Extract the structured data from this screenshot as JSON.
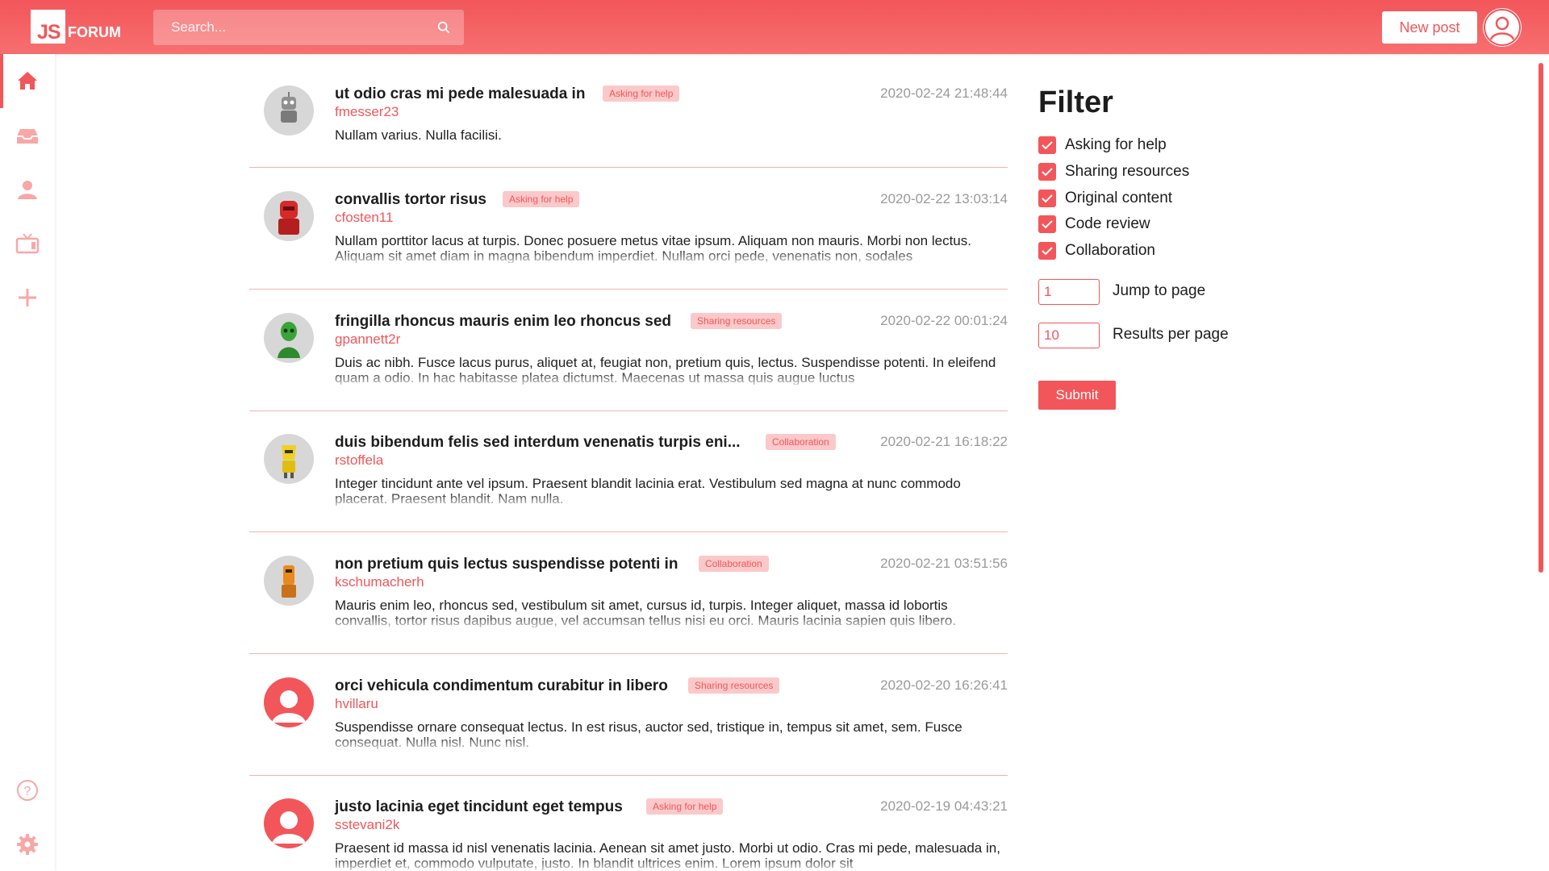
{
  "app": {
    "logo_left": "JS",
    "logo_right": "FORUM",
    "search_placeholder": "Search...",
    "new_post_label": "New post"
  },
  "sidebar": {
    "items": [
      {
        "icon": "home-icon"
      },
      {
        "icon": "inbox-icon"
      },
      {
        "icon": "user-icon"
      },
      {
        "icon": "tv-icon"
      },
      {
        "icon": "plus-icon"
      },
      {
        "icon": "help-icon"
      },
      {
        "icon": "settings-icon"
      }
    ]
  },
  "posts": [
    {
      "title": "ut odio cras mi pede malesuada in",
      "tag": "Asking for help",
      "author": "fmesser23",
      "date": "2020-02-24 21:48:44",
      "body": "Nullam varius. Nulla facilisi.",
      "avatar": "robot-grey"
    },
    {
      "title": "convallis tortor risus",
      "tag": "Asking for help",
      "author": "cfosten11",
      "date": "2020-02-22 13:03:14",
      "body": "Nullam porttitor lacus at turpis. Donec posuere metus vitae ipsum. Aliquam non mauris. Morbi non lectus. Aliquam sit amet diam in magna bibendum imperdiet. Nullam orci pede, venenatis non, sodales",
      "avatar": "robot-red"
    },
    {
      "title": "fringilla rhoncus mauris enim leo rhoncus sed",
      "tag": "Sharing resources",
      "author": "gpannett2r",
      "date": "2020-02-22 00:01:24",
      "body": "Duis ac nibh. Fusce lacus purus, aliquet at, feugiat non, pretium quis, lectus. Suspendisse potenti. In eleifend quam a odio. In hac habitasse platea dictumst. Maecenas ut massa quis augue luctus",
      "avatar": "robot-green"
    },
    {
      "title": "duis bibendum felis sed interdum venenatis turpis eni...",
      "tag": "Collaboration",
      "author": "rstoffela",
      "date": "2020-02-21 16:18:22",
      "body": "Integer tincidunt ante vel ipsum. Praesent blandit lacinia erat. Vestibulum sed magna at nunc commodo placerat. Praesent blandit. Nam nulla.",
      "avatar": "robot-yellow"
    },
    {
      "title": "non pretium quis lectus suspendisse potenti in",
      "tag": "Collaboration",
      "author": "kschumacherh",
      "date": "2020-02-21 03:51:56",
      "body": "Mauris enim leo, rhoncus sed, vestibulum sit amet, cursus id, turpis. Integer aliquet, massa id lobortis convallis, tortor risus dapibus augue, vel accumsan tellus nisi eu orci. Mauris lacinia sapien quis libero.",
      "avatar": "robot-orange"
    },
    {
      "title": "orci vehicula condimentum curabitur in libero",
      "tag": "Sharing resources",
      "author": "hvillaru",
      "date": "2020-02-20 16:26:41",
      "body": "Suspendisse ornare consequat lectus. In est risus, auctor sed, tristique in, tempus sit amet, sem. Fusce consequat. Nulla nisl. Nunc nisl.",
      "avatar": "default-user"
    },
    {
      "title": "justo lacinia eget tincidunt eget tempus",
      "tag": "Asking for help",
      "author": "sstevani2k",
      "date": "2020-02-19 04:43:21",
      "body": "Praesent id massa id nisl venenatis lacinia. Aenean sit amet justo. Morbi ut odio. Cras mi pede, malesuada in, imperdiet et, commodo vulputate, justo. In blandit ultrices enim. Lorem ipsum dolor sit",
      "avatar": "default-user"
    }
  ],
  "filter": {
    "title": "Filter",
    "options": [
      {
        "label": "Asking for help",
        "checked": true
      },
      {
        "label": "Sharing resources",
        "checked": true
      },
      {
        "label": "Original content",
        "checked": true
      },
      {
        "label": "Code review",
        "checked": true
      },
      {
        "label": "Collaboration",
        "checked": true
      }
    ],
    "jump_to_page_label": "Jump to page",
    "jump_to_page_value": "1",
    "results_per_page_label": "Results per page",
    "results_per_page_value": "10",
    "submit_label": "Submit"
  },
  "colors": {
    "accent": "#f2565a",
    "tag_bg": "#fbc9c9"
  }
}
